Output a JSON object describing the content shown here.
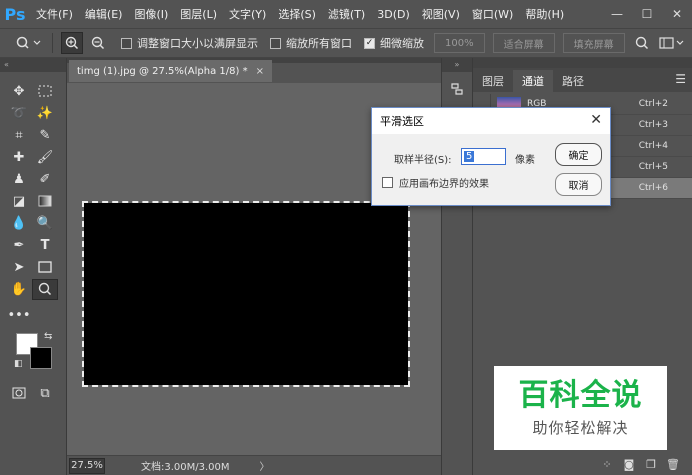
{
  "app": {
    "logo": "Ps"
  },
  "menu": [
    "文件(F)",
    "编辑(E)",
    "图像(I)",
    "图层(L)",
    "文字(Y)",
    "选择(S)",
    "滤镜(T)",
    "3D(D)",
    "视图(V)",
    "窗口(W)",
    "帮助(H)"
  ],
  "window_controls": {
    "minimize": "—",
    "restore": "☐",
    "close": "✕"
  },
  "options": {
    "resize_windows_label": "调整窗口大小以满屏显示",
    "resize_windows_checked": false,
    "zoom_all_label": "缩放所有窗口",
    "zoom_all_checked": false,
    "scrubby_zoom_label": "细微缩放",
    "scrubby_zoom_checked": true,
    "btn_100": "100%",
    "btn_fit": "适合屏幕",
    "btn_fill": "填充屏幕"
  },
  "document": {
    "tab_title": "timg (1).jpg @ 27.5%(Alpha 1/8) *",
    "tab_close": "×",
    "zoom": "27.5%",
    "doc_size": "文档:3.00M/3.00M",
    "status_arrow": "〉"
  },
  "panel": {
    "tabs": [
      "图层",
      "通道",
      "路径"
    ],
    "active_tab": 1,
    "channels": [
      {
        "name": "RGB",
        "shortcut": "Ctrl+2"
      },
      {
        "name": "",
        "shortcut": "Ctrl+3"
      },
      {
        "name": "",
        "shortcut": "Ctrl+4"
      },
      {
        "name": "",
        "shortcut": "Ctrl+5"
      },
      {
        "name": "",
        "shortcut": "Ctrl+6"
      }
    ]
  },
  "dialog": {
    "title": "平滑选区",
    "close": "✕",
    "radius_label": "取样半径(S):",
    "radius_value": "5",
    "radius_unit": "像素",
    "edge_label": "应用画布边界的效果",
    "edge_checked": false,
    "ok_label": "确定",
    "cancel_label": "取消"
  },
  "watermark": {
    "title": "百科全说",
    "subtitle": "助你轻松解决"
  },
  "colors": {
    "foreground": "#ffffff",
    "background": "#000000",
    "watermark_green": "#1bb34a",
    "ps_blue": "#31a8ff"
  }
}
